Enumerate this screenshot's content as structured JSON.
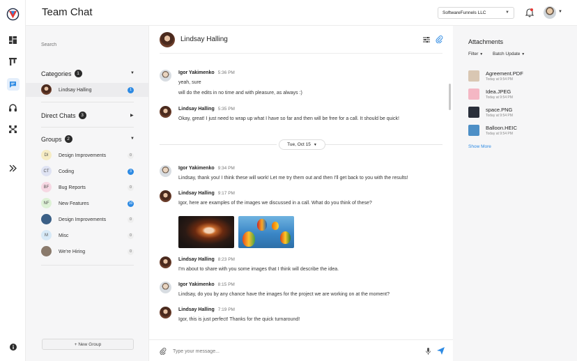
{
  "app": {
    "title": "Team Chat"
  },
  "header": {
    "company": "SoftwareFunnels LLC"
  },
  "rail": {
    "items": [
      "dashboard",
      "kanban",
      "chat",
      "support",
      "structure",
      "expand"
    ]
  },
  "sidebar": {
    "search_placeholder": "Search",
    "categories": {
      "label": "Categories",
      "count": "1",
      "items": [
        {
          "label": "Lindsay Halling",
          "badge": "1"
        }
      ]
    },
    "direct_chats": {
      "label": "Direct Chats",
      "count": "3"
    },
    "groups": {
      "label": "Groups",
      "count": "2",
      "items": [
        {
          "initials": "DI",
          "label": "Design Improvements",
          "badge": "0",
          "color": "#f6ecc4"
        },
        {
          "initials": "CT",
          "label": "Coding",
          "badge": "3",
          "color": "#dfe3f3"
        },
        {
          "initials": "BF",
          "label": "Bug Reports",
          "badge": "0",
          "color": "#f6d8e3"
        },
        {
          "initials": "NF",
          "label": "New Features",
          "badge": "10",
          "color": "#ddf1d6"
        },
        {
          "initials": "",
          "label": "Design Improvements",
          "badge": "0",
          "color": "#3b5f86"
        },
        {
          "initials": "M",
          "label": "Misc",
          "badge": "0",
          "color": "#d7e9f7"
        },
        {
          "initials": "",
          "label": "We're Hiring",
          "badge": "0",
          "color": "#8a7a6c"
        }
      ]
    },
    "new_group": "+ New Group"
  },
  "chat": {
    "contact": "Lindsay Halling",
    "date_separator": "Tue, Oct 15",
    "message_placeholder": "Type your message...",
    "messages": [
      {
        "author": "Igor Yakimenko",
        "time": "5:36 PM",
        "lines": [
          "yeah, sure",
          "will do the edits in no time and with pleasure, as always :)"
        ]
      },
      {
        "author": "Lindsay Halling",
        "time": "5:35 PM",
        "lines": [
          "Okay, great! I just need to wrap up what I have so far and then will be free for a call. It should be quick!"
        ]
      },
      {
        "author": "Igor Yakimenko",
        "time": "9:34 PM",
        "lines": [
          "Lindsay, thank you! I think these will work! Let me try them out and then I'll get back to you with the results!"
        ]
      },
      {
        "author": "Lindsay Halling",
        "time": "9:17 PM",
        "lines": [
          "Igor, here are examples of the images we discussed in a call. What do you think of these?"
        ]
      },
      {
        "author": "Lindsay Halling",
        "time": "8:23 PM",
        "lines": [
          "I'm about to share with you some images that I think will describe the idea."
        ]
      },
      {
        "author": "Igor Yakimenko",
        "time": "8:15 PM",
        "lines": [
          "Lindsay, do you by any chance have the images for the project we are working on at the moment?"
        ]
      },
      {
        "author": "Lindsay Halling",
        "time": "7:19 PM",
        "lines": [
          "Igor, this is just perfect! Thanks for the quick turnaround!"
        ]
      }
    ]
  },
  "attachments": {
    "title": "Attachments",
    "filter": "Filter",
    "batch": "Batch Update",
    "files": [
      {
        "name": "Agreement.PDF",
        "date": "Today at 9:54 PM",
        "color": "#d9c7b3"
      },
      {
        "name": "Idea.JPEG",
        "date": "Today at 9:54 PM",
        "color": "#f4b7c4"
      },
      {
        "name": "space.PNG",
        "date": "Today at 9:54 PM",
        "color": "#2a2f3a"
      },
      {
        "name": "Balloon.HEIC",
        "date": "Today at 9:54 PM",
        "color": "#4d8fc6"
      }
    ],
    "show_more": "Show More"
  },
  "colors": {
    "accent": "#2d8ae3",
    "notify": "#e53935"
  }
}
